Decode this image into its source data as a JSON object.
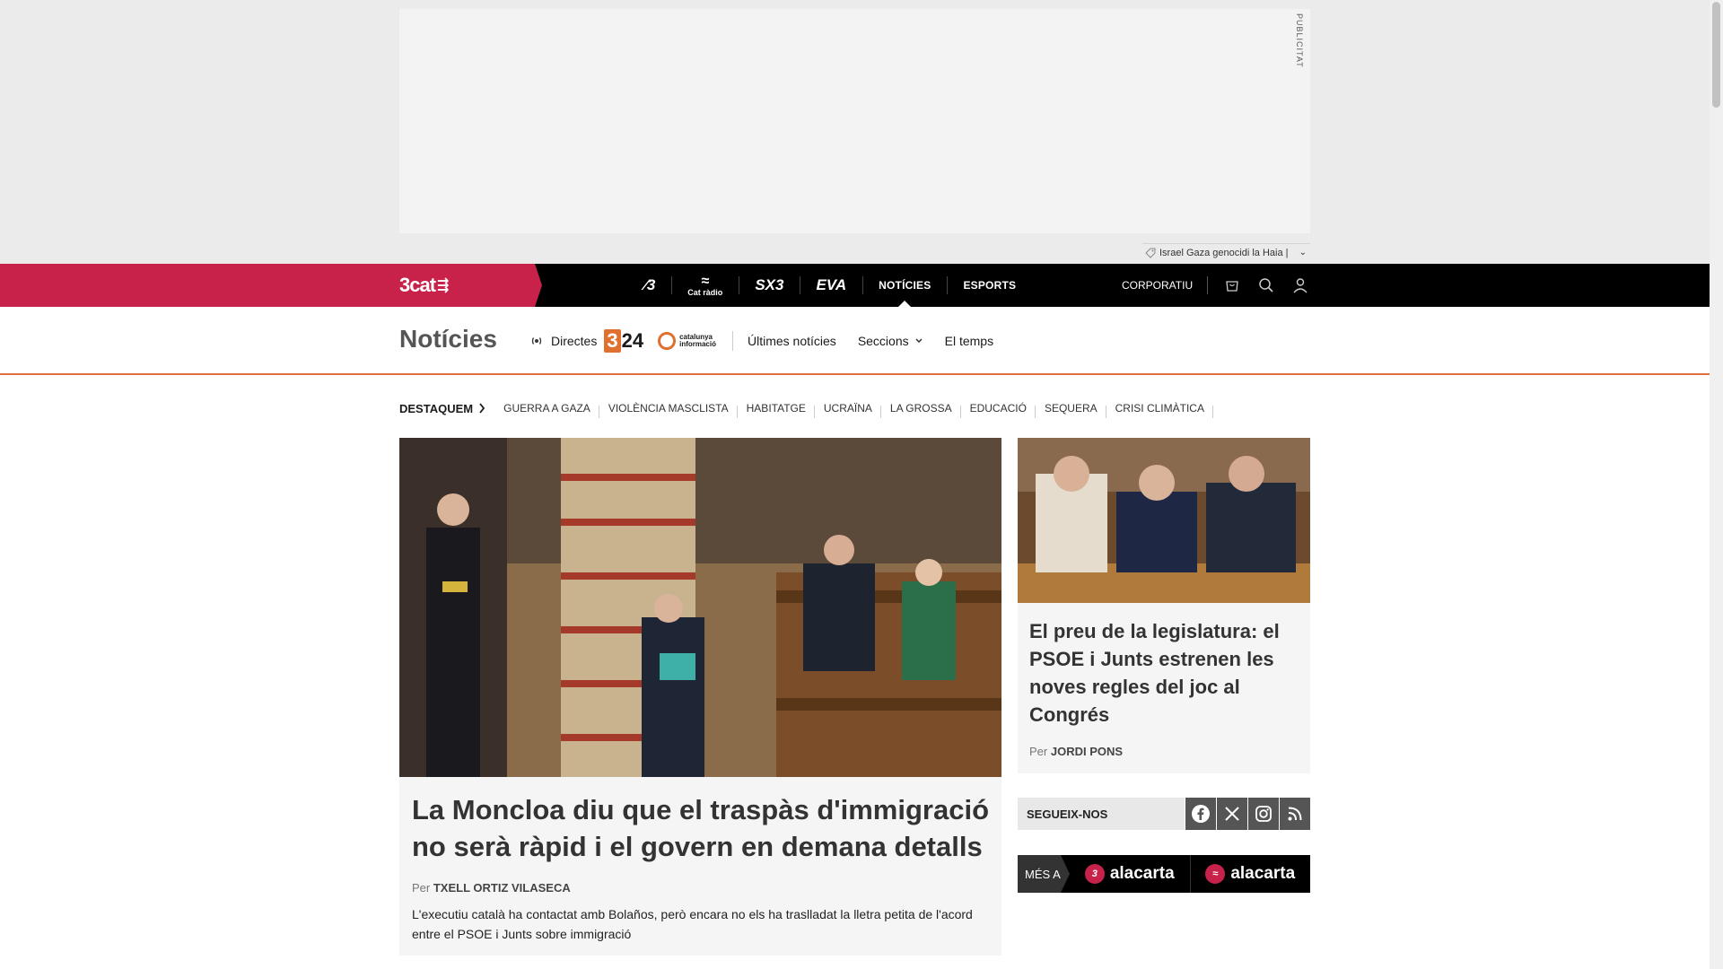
{
  "ad": {
    "label": "PUBLICITAT"
  },
  "tag_strip": {
    "text": "Israel Gaza genocidi la Haia |"
  },
  "topbar": {
    "brand": "3cat",
    "channels": [
      {
        "label": "3",
        "icon": "tv3-logo"
      },
      {
        "label": "Cat ràdio",
        "icon": "catradio-logo"
      },
      {
        "label": "SX3",
        "icon": "sx3-logo"
      },
      {
        "label": "EVA",
        "icon": "eva-logo"
      },
      {
        "label": "NOTÍCIES",
        "active": true
      },
      {
        "label": "ESPORTS"
      }
    ],
    "corporatiu": "CORPORATIU"
  },
  "section": {
    "title": "Notícies",
    "directes": "Directes",
    "logo_324": "324",
    "logo_ci_line1": "catalunya",
    "logo_ci_line2": "informació",
    "links": [
      "Últimes notícies",
      "Seccions",
      "El temps"
    ]
  },
  "trending": {
    "lead": "DESTAQUEM",
    "items": [
      "GUERRA A GAZA",
      "VIOLÈNCIA MASCLISTA",
      "HABITATGE",
      "UCRAÏNA",
      "LA GROSSA",
      "EDUCACIÓ",
      "SEQUERA",
      "CRISI CLIMÀTICA"
    ]
  },
  "main_article": {
    "headline": "La Moncloa diu que el traspàs d'immigració no serà ràpid i el govern en demana detalls",
    "by_prefix": "Per",
    "author": "TXELL ORTIZ VILASECA",
    "summary": "L'executiu català ha contactat amb Bolaños, però encara no els ha traslladat la lletra petita de l'acord entre el PSOE i Junts sobre immigració"
  },
  "side_article": {
    "headline": "El preu de la legislatura: el PSOE i Junts estrenen les noves regles del joc al Congrés",
    "by_prefix": "Per",
    "author": "JORDI PONS"
  },
  "follow": {
    "label": "SEGUEIX-NOS",
    "networks": [
      "facebook-icon",
      "x-icon",
      "instagram-icon",
      "rss-icon"
    ]
  },
  "mesa": {
    "label": "MÉS A",
    "items": [
      "alacarta",
      "alacarta"
    ]
  },
  "colors": {
    "brand": "#c8224a",
    "accent": "#e07040",
    "topbar": "#000000"
  }
}
